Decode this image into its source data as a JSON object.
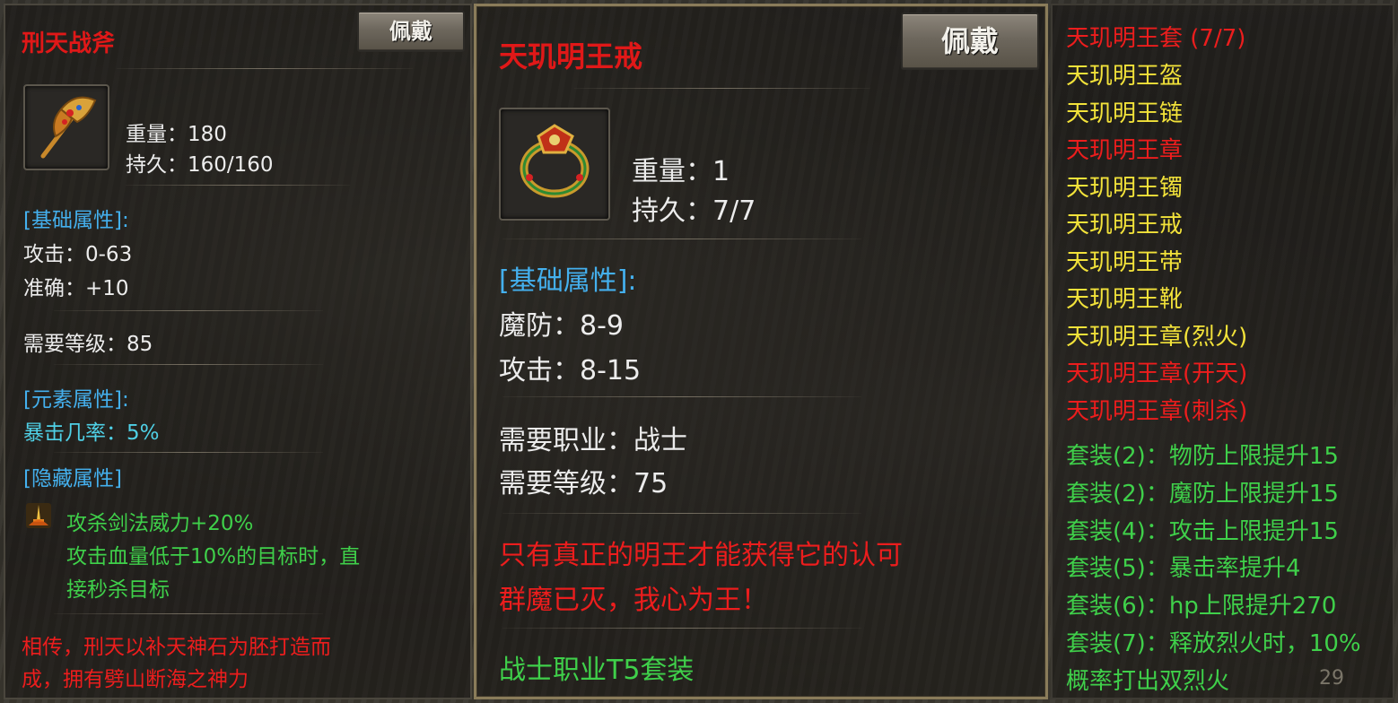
{
  "panel_left": {
    "title": "刑天战斧",
    "equip_label": "佩戴",
    "icon": "axe-icon",
    "weight": "重量：180",
    "durability": "持久：160/160",
    "basic_header": "[基础属性]:",
    "attack": "攻击：0-63",
    "accuracy": "准确：+10",
    "level_req": "需要等级：85",
    "element_header": "[元素属性]:",
    "crit": "暴击几率：5%",
    "hidden_header": "[隐藏属性]",
    "skill_icon": "sword-skill-icon",
    "hidden_1": "攻杀剑法威力+20%",
    "hidden_2": "攻击血量低于10%的目标时，直",
    "hidden_3": "接秒杀目标",
    "lore_1": "相传，刑天以补天神石为胚打造而",
    "lore_2": "成，拥有劈山断海之神力"
  },
  "panel_center": {
    "title": "天玑明王戒",
    "equip_label": "佩戴",
    "icon": "ring-icon",
    "weight": "重量：1",
    "durability": "持久：7/7",
    "basic_header": "[基础属性]:",
    "magic_def": "魔防：8-9",
    "attack": "攻击：8-15",
    "class_req": "需要职业：战士",
    "level_req": "需要等级：75",
    "lore_1": "只有真正的明王才能获得它的认可",
    "lore_2": "群魔已灭，我心为王！",
    "set_name": "战士职业T5套装"
  },
  "panel_right": {
    "set_title": "天玑明王套 (7/7)",
    "items": [
      {
        "text": "天玑明王盔",
        "color": "#f2e23a"
      },
      {
        "text": "天玑明王链",
        "color": "#f2e23a"
      },
      {
        "text": "天玑明王章",
        "color": "#ec1d1d"
      },
      {
        "text": "天玑明王镯",
        "color": "#f2e23a"
      },
      {
        "text": "天玑明王戒",
        "color": "#f2e23a"
      },
      {
        "text": "天玑明王带",
        "color": "#f2e23a"
      },
      {
        "text": "天玑明王靴",
        "color": "#f2e23a"
      },
      {
        "text": "天玑明王章(烈火)",
        "color": "#f2e23a"
      },
      {
        "text": "天玑明王章(开天)",
        "color": "#ec1d1d"
      },
      {
        "text": "天玑明王章(刺杀)",
        "color": "#ec1d1d"
      }
    ],
    "bonuses": [
      "套装(2)：物防上限提升15",
      "套装(2)：魔防上限提升15",
      "套装(4)：攻击上限提升15",
      "套装(5)：暴击率提升4",
      "套装(6)：hp上限提升270",
      "套装(7)：释放烈火时，10%",
      "概率打出双烈火"
    ],
    "page_number": "29"
  },
  "colors": {
    "title_red": "#e01818",
    "attr_header_cyan": "#44b0ee",
    "hidden_green": "#3fd04a",
    "set_yellow": "#f2e23a",
    "set_red": "#ec1d1d"
  }
}
